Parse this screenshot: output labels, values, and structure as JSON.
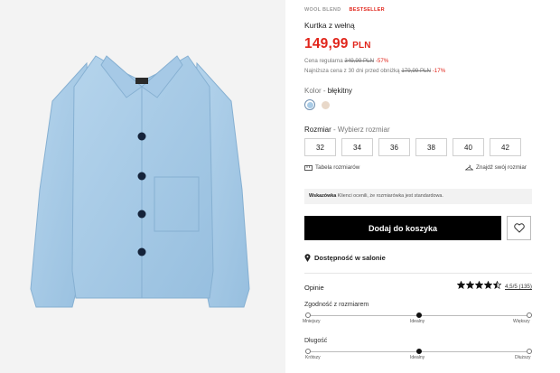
{
  "product": {
    "badges": [
      "WOOL BLEND",
      "BESTSELLER"
    ],
    "title": "Kurtka z wełną",
    "price": "149,99",
    "currency": "PLN",
    "regular_price_label": "Cena regularna",
    "regular_price": "349,99 PLN",
    "regular_discount": "-57%",
    "lowest_price_label": "Najniższa cena z 30 dni przed obniżką",
    "lowest_price": "179,99 PLN",
    "lowest_discount": "-17%"
  },
  "color": {
    "label": "Kolor - ",
    "selected": "błękitny",
    "swatches": [
      "#a9cbe6",
      "#e8d8c9"
    ]
  },
  "size": {
    "label": "Rozmiar",
    "prompt": " - Wybierz rozmiar",
    "options": [
      "32",
      "34",
      "36",
      "38",
      "40",
      "42"
    ]
  },
  "links": {
    "size_chart": "Tabela rozmiarów",
    "find_size": "Znajdź swój rozmiar"
  },
  "hint": {
    "title": "Wskazówka",
    "text": " Klienci ocenili, że rozmiarówka jest standardowa."
  },
  "actions": {
    "add_to_cart": "Dodaj do koszyka"
  },
  "store": {
    "label": "Dostępność w salonie"
  },
  "reviews": {
    "label": "Opinie",
    "rating": 4.5,
    "rating_text": "4,5/5 (135)",
    "fit": {
      "label": "Zgodność z rozmiarem",
      "scale": [
        "Mniejszy",
        "Idealny",
        "Większy"
      ],
      "value": 0.5
    },
    "length": {
      "label": "Długość",
      "scale": [
        "Krótszy",
        "Idealny",
        "Dłuższy"
      ],
      "value": 0.5
    }
  },
  "colors": {
    "accent": "#e1251b",
    "button": "#000000",
    "jacket": "#a9cbe6"
  }
}
